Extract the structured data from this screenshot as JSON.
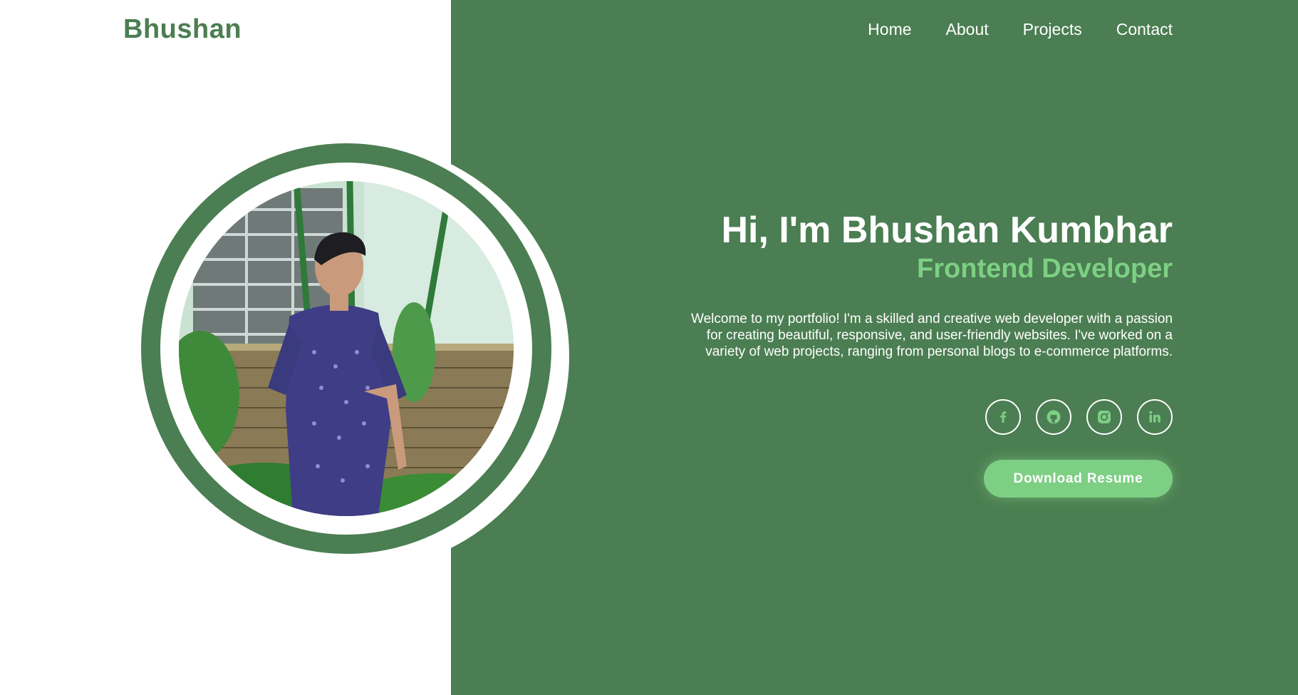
{
  "brand": {
    "logo_text": "Bhushan"
  },
  "nav": {
    "items": [
      {
        "label": "Home"
      },
      {
        "label": "About"
      },
      {
        "label": "Projects"
      },
      {
        "label": "Contact"
      }
    ]
  },
  "hero": {
    "greeting": "Hi, I'm Bhushan Kumbhar",
    "role": "Frontend Developer",
    "intro": "Welcome to my portfolio! I'm a skilled and creative web developer with a passion for creating beautiful, responsive, and user-friendly websites. I've worked on a variety of web projects, ranging from personal blogs to e-commerce platforms.",
    "download_button": "Download Resume"
  },
  "socials": [
    {
      "icon": "facebook-icon"
    },
    {
      "icon": "github-icon"
    },
    {
      "icon": "instagram-icon"
    },
    {
      "icon": "linkedin-icon"
    }
  ],
  "colors": {
    "primary_green": "#4b7e52",
    "accent_green": "#7dcf84",
    "background": "#ffffff",
    "text_light": "#ffffff"
  }
}
